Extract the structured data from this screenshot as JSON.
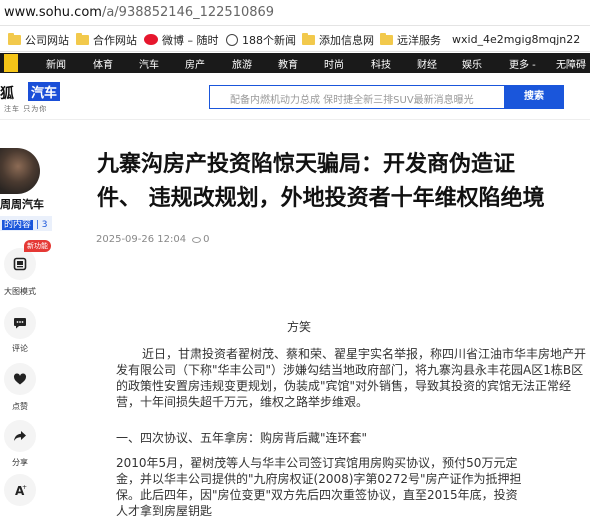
{
  "address_bar": {
    "host": "www.sohu.com",
    "path": "/a/938852146_122510869"
  },
  "bookmarks": [
    {
      "label": "公司网站",
      "icon": "folder-icon"
    },
    {
      "label": "合作网站",
      "icon": "folder-icon"
    },
    {
      "label": "微博 – 随时",
      "icon": "weibo-icon"
    },
    {
      "label": "188个新闻",
      "icon": "globe-icon"
    },
    {
      "label": "添加信息网",
      "icon": "folder-icon"
    },
    {
      "label": "远洋服务",
      "icon": "folder-icon"
    },
    {
      "label": "wxid_4e2mgig8mqjn22",
      "icon": ""
    }
  ],
  "top_nav": [
    "新闻",
    "体育",
    "汽车",
    "房产",
    "旅游",
    "教育",
    "时尚",
    "科技",
    "财经",
    "娱乐",
    "更多 -",
    "无障碍"
  ],
  "brand": {
    "text1": "狐",
    "text2": "汽车",
    "slogan": "注车 只为你"
  },
  "search": {
    "placeholder": "配备内燃机动力总成 保时捷全新三排SUV最新消息曝光",
    "button": "搜索"
  },
  "sidebar": {
    "author_name": "周周汽车",
    "content_label": "的内容",
    "content_count": "3",
    "new_badge": "新功能",
    "actions": [
      {
        "label": "大图模式",
        "icon": "big-image-icon"
      },
      {
        "label": "评论",
        "icon": "comment-icon"
      },
      {
        "label": "点赞",
        "icon": "heart-icon"
      },
      {
        "label": "分享",
        "icon": "share-icon"
      },
      {
        "label": "",
        "icon": "font-size-icon"
      }
    ]
  },
  "article": {
    "title_line1": "九寨沟房产投资陷惊天骗局：开发商伪造证",
    "title_line2": "件、 违规改规划，外地投资者十年维权陷绝境",
    "date": "2025-09-26 12:04",
    "views": "0",
    "author": "方笑",
    "paragraph1": "近日，甘肃投资者翟树茂、蔡和荣、翟星宇实名举报，称四川省江油市华丰房地产开发有限公司（下称\"华丰公司\"）涉嫌勾结当地政府部门，将九寨沟县永丰花园A区1栋B区的政策性安置房违规变更规划，伪装成\"宾馆\"对外销售，导致其投资的宾馆无法正常经营，十年间损失超千万元，维权之路举步维艰。",
    "heading1": "一、四次协议、五年拿房：购房背后藏\"连环套\"",
    "paragraph2_lines": [
      "2010年5月，翟树茂等人与华丰公司签订宾馆用房购买协议，预付50万元定",
      "金，并以华丰公司提供的\"九府房权证(2008)字第0272号\"房产证作为抵押担",
      "保。此后四年，因\"房位变更\"双方先后四次重签协议，直至2015年底，投资",
      "人才拿到房屋钥匙"
    ]
  }
}
